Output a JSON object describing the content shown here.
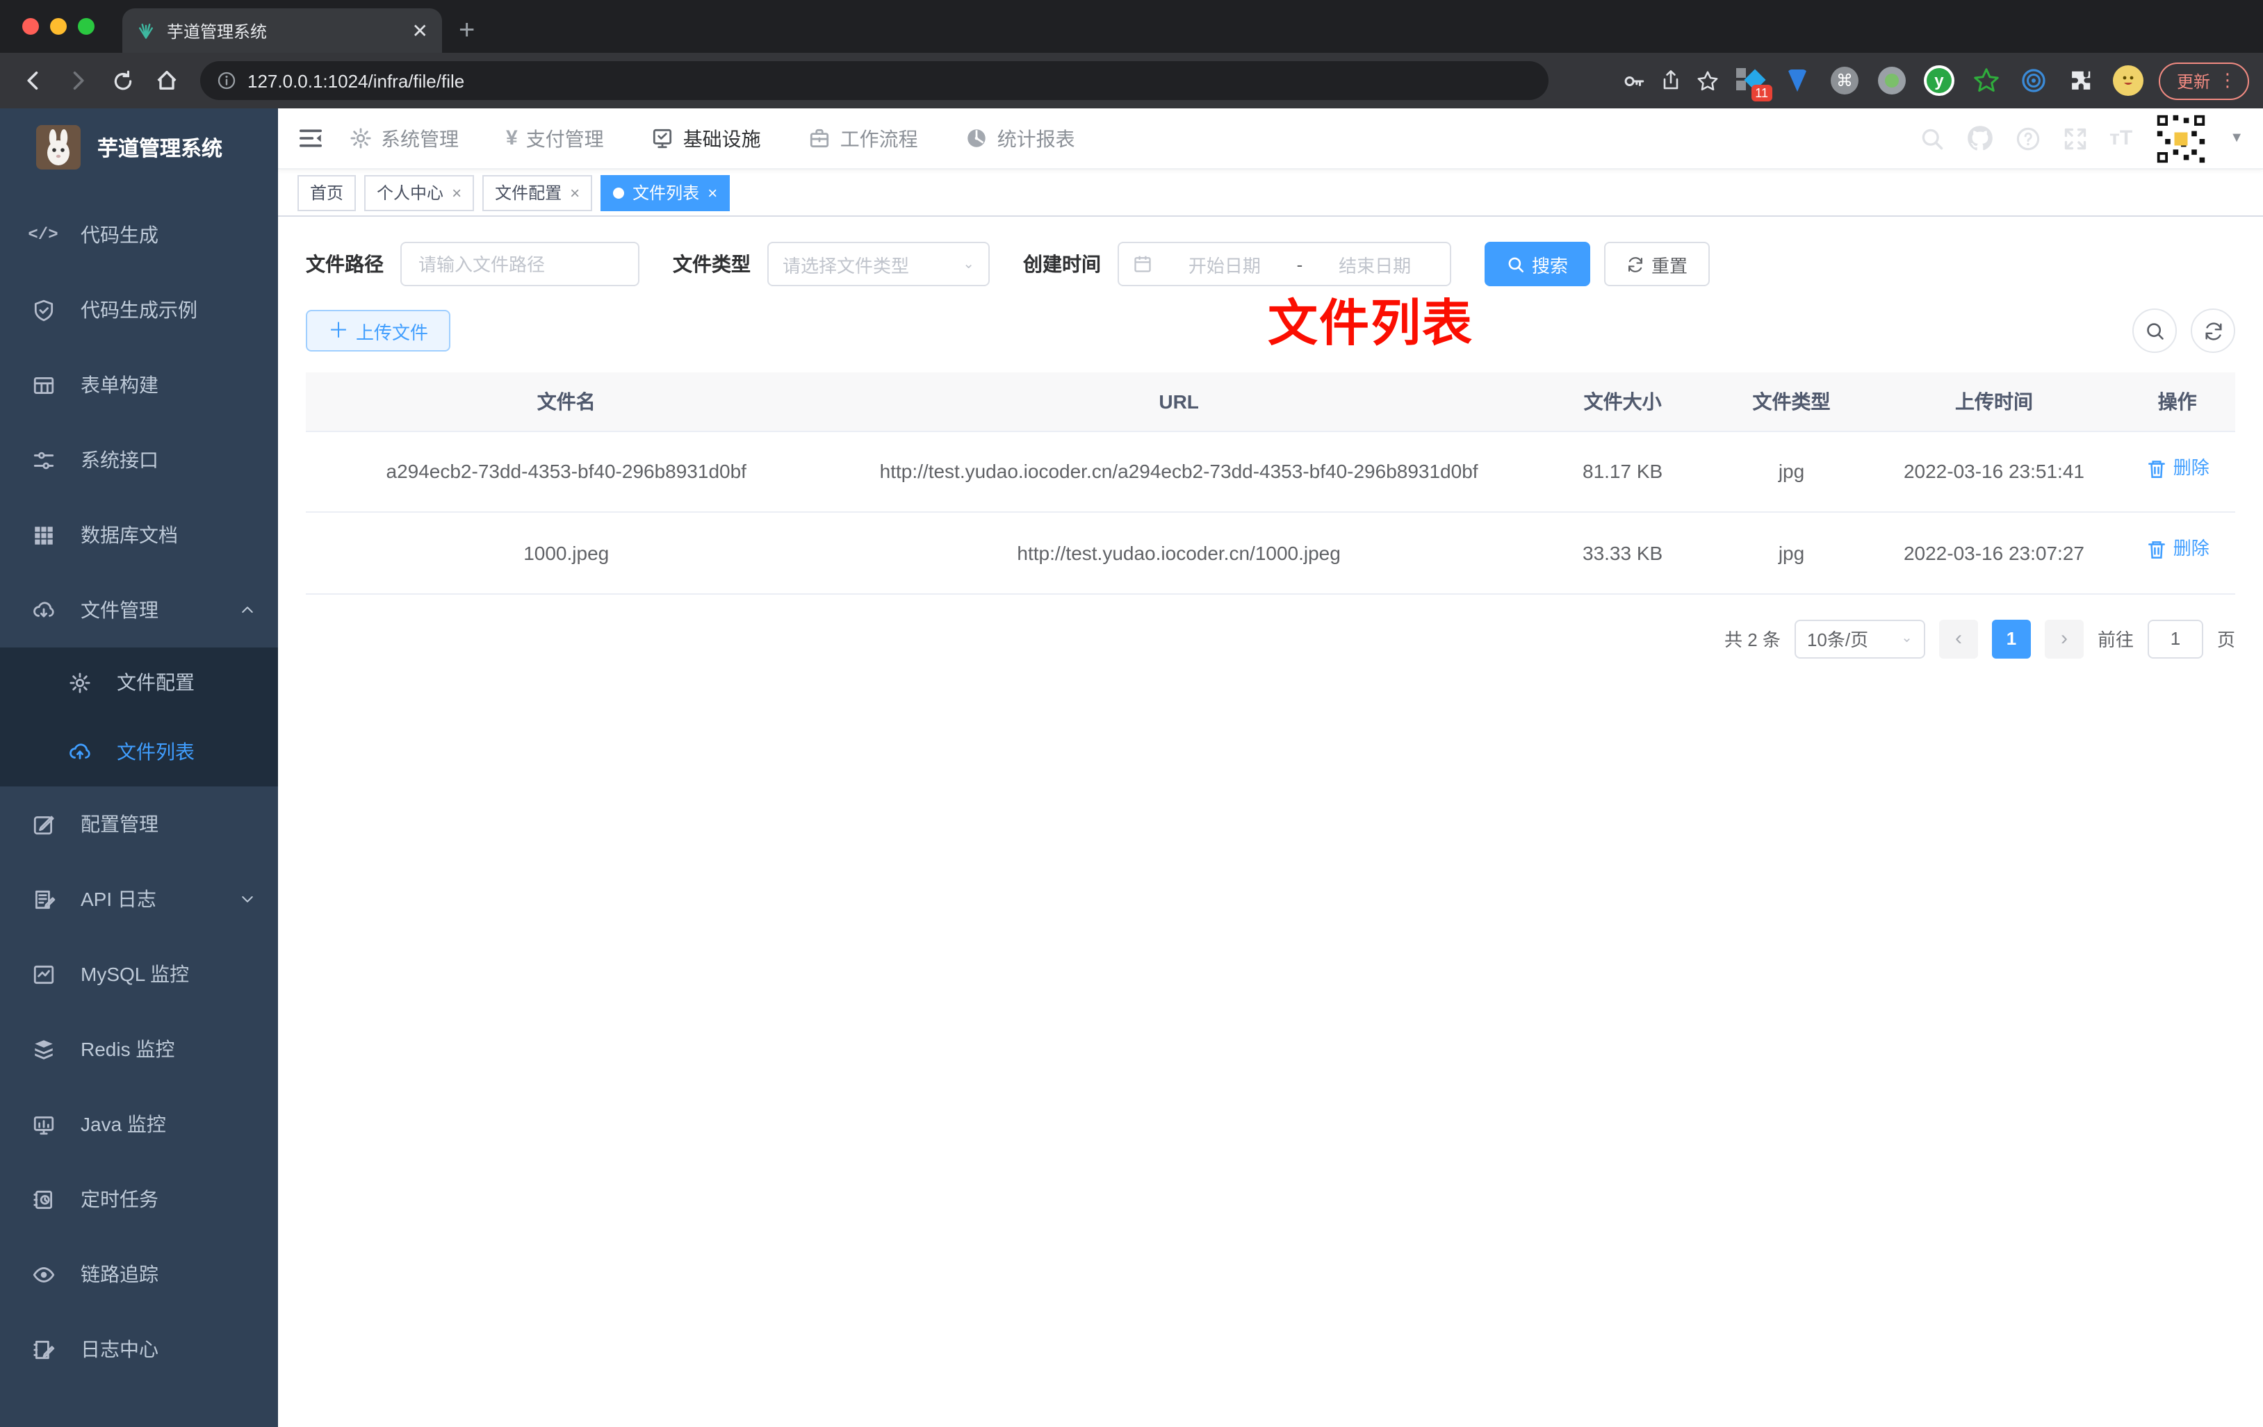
{
  "browser": {
    "tab_title": "芋道管理系统",
    "url": "127.0.0.1:1024/infra/file/file",
    "ext_badge": "11",
    "update_label": "更新"
  },
  "sidebar": {
    "title": "芋道管理系统",
    "items": [
      {
        "id": "code-gen",
        "icon": "code-icon",
        "label": "代码生成"
      },
      {
        "id": "code-demo",
        "icon": "shield-check-icon",
        "label": "代码生成示例"
      },
      {
        "id": "form-build",
        "icon": "form-icon",
        "label": "表单构建"
      },
      {
        "id": "system-api",
        "icon": "sliders-icon",
        "label": "系统接口"
      },
      {
        "id": "db-doc",
        "icon": "grid-icon",
        "label": "数据库文档"
      },
      {
        "id": "file-manage",
        "icon": "cloud-download-icon",
        "label": "文件管理",
        "chevron": "up",
        "children": [
          {
            "id": "file-config",
            "icon": "gear-icon",
            "label": "文件配置"
          },
          {
            "id": "file-list",
            "icon": "cloud-upload-icon",
            "label": "文件列表",
            "active": true
          }
        ]
      },
      {
        "id": "config-manage",
        "icon": "edit-icon",
        "label": "配置管理"
      },
      {
        "id": "api-log",
        "icon": "doc-edit-icon",
        "label": "API 日志",
        "chevron": "down"
      },
      {
        "id": "mysql-monitor",
        "icon": "chart-icon",
        "label": "MySQL 监控"
      },
      {
        "id": "redis-monitor",
        "icon": "layers-icon",
        "label": "Redis 监控"
      },
      {
        "id": "java-monitor",
        "icon": "monitor-icon",
        "label": "Java 监控"
      },
      {
        "id": "job",
        "icon": "schedule-icon",
        "label": "定时任务"
      },
      {
        "id": "trace",
        "icon": "eye-icon",
        "label": "链路追踪"
      },
      {
        "id": "log-center",
        "icon": "note-edit-icon",
        "label": "日志中心"
      }
    ]
  },
  "navbar": {
    "menus": [
      {
        "id": "system",
        "icon": "gear-icon",
        "label": "系统管理"
      },
      {
        "id": "pay",
        "icon": "yen-icon",
        "label": "支付管理"
      },
      {
        "id": "infra",
        "icon": "infra-icon",
        "label": "基础设施",
        "active": true
      },
      {
        "id": "workflow",
        "icon": "briefcase-icon",
        "label": "工作流程"
      },
      {
        "id": "report",
        "icon": "dashboard-icon",
        "label": "统计报表"
      }
    ]
  },
  "tags": [
    {
      "label": "首页",
      "closable": false,
      "active": false
    },
    {
      "label": "个人中心",
      "closable": true,
      "active": false
    },
    {
      "label": "文件配置",
      "closable": true,
      "active": false
    },
    {
      "label": "文件列表",
      "closable": true,
      "active": true
    }
  ],
  "annotation": "文件列表",
  "filter": {
    "path_label": "文件路径",
    "path_placeholder": "请输入文件路径",
    "type_label": "文件类型",
    "type_placeholder": "请选择文件类型",
    "time_label": "创建时间",
    "start_placeholder": "开始日期",
    "separator": "-",
    "end_placeholder": "结束日期",
    "search_label": "搜索",
    "reset_label": "重置"
  },
  "toolbar": {
    "upload_label": "上传文件"
  },
  "table": {
    "headers": [
      "文件名",
      "URL",
      "文件大小",
      "文件类型",
      "上传时间",
      "操作"
    ],
    "col_keys": [
      "name",
      "url",
      "size",
      "type",
      "time",
      "action"
    ],
    "rows": [
      {
        "name": "a294ecb2-73dd-4353-bf40-296b8931d0bf",
        "url": "http://test.yudao.iocoder.cn/a294ecb2-73dd-4353-bf40-296b8931d0bf",
        "size": "81.17 KB",
        "type": "jpg",
        "time": "2022-03-16 23:51:41",
        "action": "删除"
      },
      {
        "name": "1000.jpeg",
        "url": "http://test.yudao.iocoder.cn/1000.jpeg",
        "size": "33.33 KB",
        "type": "jpg",
        "time": "2022-03-16 23:07:27",
        "action": "删除"
      }
    ]
  },
  "pagination": {
    "total": "共 2 条",
    "page_size": "10条/页",
    "current": "1",
    "goto_label": "前往",
    "page_value": "1",
    "unit_label": "页"
  },
  "colors": {
    "primary": "#409eff",
    "sidebar_bg": "#304156",
    "submenu_bg": "#1f2d3d",
    "annotation": "#fb0e01"
  }
}
